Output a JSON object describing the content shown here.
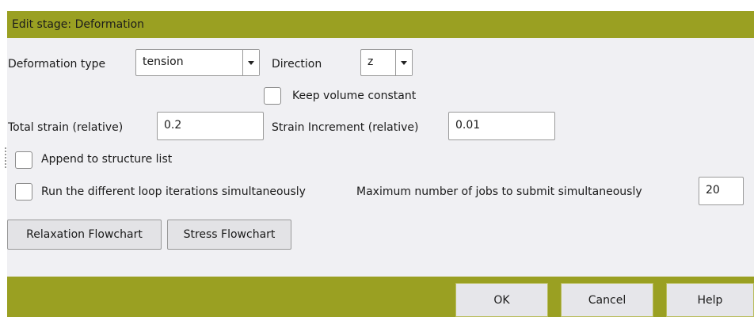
{
  "dialog": {
    "title": "Edit stage: Deformation"
  },
  "deformation_type": {
    "label": "Deformation type",
    "value": "tension"
  },
  "direction": {
    "label": "Direction",
    "value": "z"
  },
  "keep_volume": {
    "label": "Keep volume constant",
    "checked": false
  },
  "total_strain": {
    "label": "Total strain (relative)",
    "value": "0.2"
  },
  "strain_increment": {
    "label": "Strain Increment (relative)",
    "value": "0.01"
  },
  "append": {
    "label": "Append to structure list",
    "checked": false
  },
  "simultaneous": {
    "label": "Run the different loop iterations simultaneously",
    "checked": false
  },
  "max_jobs": {
    "label": "Maximum number of jobs to submit simultaneously",
    "value": "20"
  },
  "buttons": {
    "relaxation": "Relaxation Flowchart",
    "stress": "Stress Flowchart"
  },
  "footer": {
    "ok": "OK",
    "cancel": "Cancel",
    "help": "Help"
  },
  "colors": {
    "accent": "#9aa022",
    "background": "#f0f0f3"
  }
}
